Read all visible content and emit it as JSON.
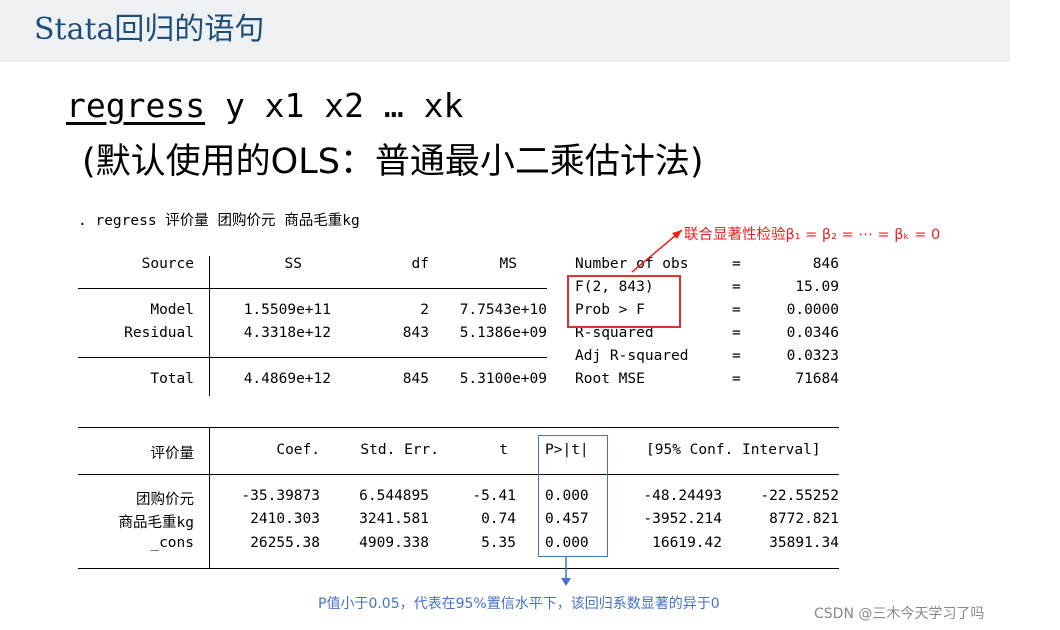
{
  "header": {
    "title": "Stata回归的语句"
  },
  "syntax": {
    "first": "regress",
    "rest": " y x1 x2 … xk",
    "note": "(默认使用的OLS：普通最小二乘估计法)"
  },
  "command": ". regress 评价量 团购价元 商品毛重kg",
  "anova": {
    "headers": [
      "Source",
      "SS",
      "df",
      "MS"
    ],
    "rows": [
      {
        "source": "Model",
        "ss": "1.5509e+11",
        "df": "2",
        "ms": "7.7543e+10"
      },
      {
        "source": "Residual",
        "ss": "4.3318e+12",
        "df": "843",
        "ms": "5.1386e+09"
      }
    ],
    "total": {
      "source": "Total",
      "ss": "4.4869e+12",
      "df": "845",
      "ms": "5.3100e+09"
    }
  },
  "stats": [
    {
      "label": "Number of obs",
      "eq": "=",
      "value": "846"
    },
    {
      "label": "F(2, 843)",
      "eq": "=",
      "value": "15.09"
    },
    {
      "label": "Prob > F",
      "eq": "=",
      "value": "0.0000"
    },
    {
      "label": "R-squared",
      "eq": "=",
      "value": "0.0346"
    },
    {
      "label": "Adj R-squared",
      "eq": "=",
      "value": "0.0323"
    },
    {
      "label": "Root MSE",
      "eq": "=",
      "value": "71684"
    }
  ],
  "coef": {
    "headers": [
      "评价量",
      "Coef.",
      "Std. Err.",
      "t",
      "P>|t|",
      "[95% Conf. Interval]"
    ],
    "rows": [
      {
        "var": "团购价元",
        "coef": "-35.39873",
        "se": "6.544895",
        "t": "-5.41",
        "p": "0.000",
        "lo": "-48.24493",
        "hi": "-22.55252"
      },
      {
        "var": "商品毛重kg",
        "coef": "2410.303",
        "se": "3241.581",
        "t": "0.74",
        "p": "0.457",
        "lo": "-3952.214",
        "hi": "8772.821"
      },
      {
        "var": "_cons",
        "coef": "26255.38",
        "se": "4909.338",
        "t": "5.35",
        "p": "0.000",
        "lo": "16619.42",
        "hi": "35891.34"
      }
    ]
  },
  "annotations": {
    "joint_test": "联合显著性检验β₁ = β₂ = ⋯ = βₖ = 0",
    "p_note": "P值小于0.05，代表在95%置信水平下，该回归系数显著的异于0"
  },
  "watermark": "CSDN @三木今天学习了吗",
  "colors": {
    "title": "#1f4e79",
    "red": "#e8211c",
    "blue": "#4472c4",
    "title_bg": "#edf1f4"
  }
}
